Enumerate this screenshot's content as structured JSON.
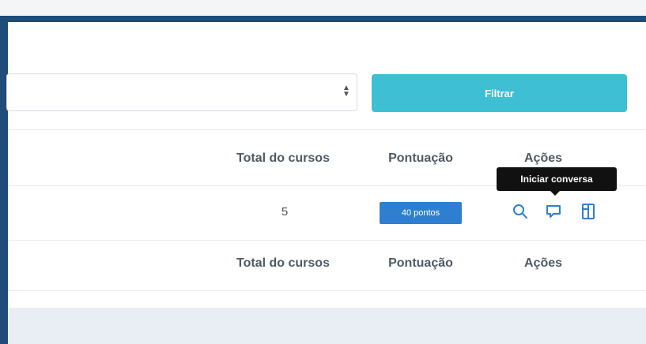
{
  "filter": {
    "button_label": "Filtrar"
  },
  "table": {
    "header": {
      "total_courses": "Total do cursos",
      "score": "Pontuação",
      "actions": "Ações"
    },
    "row": {
      "total_courses": "5",
      "score_badge": "40 pontos"
    },
    "footer": {
      "total_courses": "Total do cursos",
      "score": "Pontuação",
      "actions": "Ações"
    }
  },
  "tooltip": {
    "text": "Iniciar conversa"
  },
  "icons": {
    "view": "search-icon",
    "chat": "chat-icon",
    "document": "document-icon"
  },
  "colors": {
    "frame": "#1f4c78",
    "filter_button": "#3ebfd4",
    "badge": "#2f7fd0",
    "icon": "#2f7fd0"
  }
}
